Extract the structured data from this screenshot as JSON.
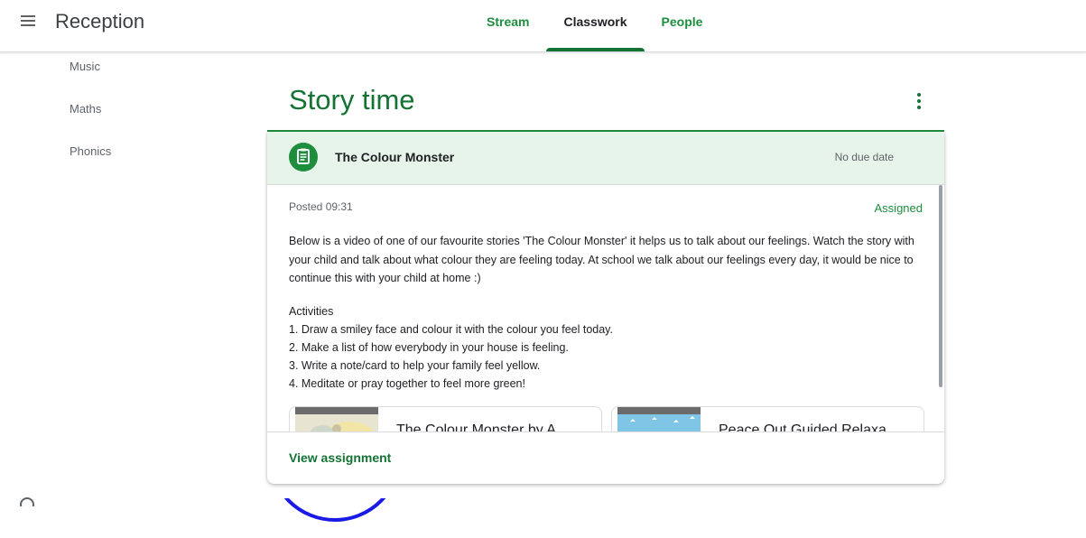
{
  "app": {
    "title": "Reception"
  },
  "nav": {
    "tabs": [
      {
        "label": "Stream"
      },
      {
        "label": "Classwork",
        "active": true
      },
      {
        "label": "People"
      }
    ]
  },
  "sidebar": {
    "items": [
      {
        "label": "Music"
      },
      {
        "label": "Maths"
      },
      {
        "label": "Phonics"
      }
    ]
  },
  "topic": {
    "title": "Story time"
  },
  "assignment": {
    "title": "The Colour Monster",
    "due": "No due date",
    "posted": "Posted 09:31",
    "status": "Assigned",
    "description": "Below is a video of one of our favourite stories 'The Colour Monster' it helps us to talk about our feelings. Watch the story with your child and talk about what colour they are feeling today. At school we talk about our feelings every day, it would be nice to continue this with your child at home :)",
    "activities_heading": "Activities",
    "activities": [
      "1. Draw a smiley face and colour it with the colour you feel today.",
      "2. Make a list of how everybody in your house is feeling.",
      "3. Write a note/card to help your family feel yellow.",
      "4. Meditate or pray together to feel more green!"
    ],
    "materials": [
      {
        "title": "The Colour Monster by A"
      },
      {
        "title": "Peace Out Guided Relaxa"
      }
    ],
    "view_label": "View assignment"
  },
  "colors": {
    "accent": "#1e8e3e",
    "accent_dark": "#137333",
    "header_bg": "#e6f4ea",
    "spinner": "#1a1ae6"
  },
  "icons": {
    "menu": "menu-icon",
    "assignment": "assignment-icon",
    "more": "more-vert-icon"
  }
}
